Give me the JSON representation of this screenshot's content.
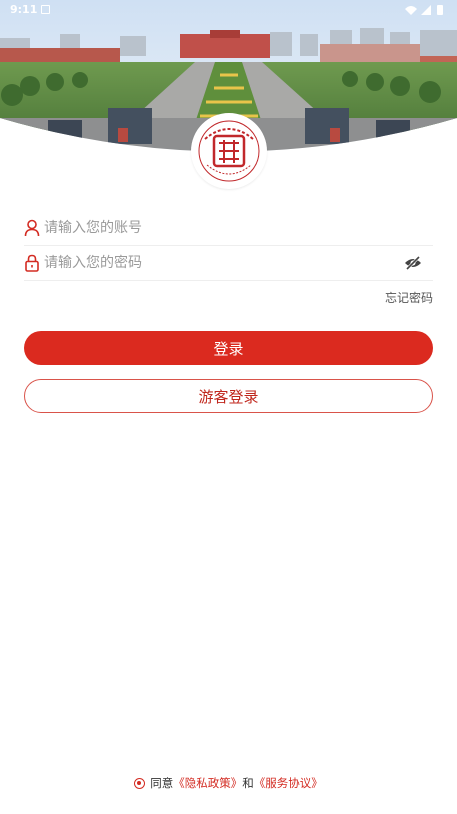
{
  "status_bar": {
    "time": "9:11"
  },
  "login_form": {
    "account_placeholder": "请输入您的账号",
    "password_placeholder": "请输入您的密码",
    "forgot_password": "忘记密码",
    "login_button": "登录",
    "guest_login_button": "游客登录"
  },
  "agreement": {
    "prefix": "同意",
    "privacy_link": "《隐私政策》",
    "conjunction": "和",
    "service_link": "《服务协议》",
    "checked": true
  },
  "colors": {
    "primary": "#db2a1f",
    "link": "#d32b22"
  },
  "icons": [
    "user-icon",
    "lock-icon",
    "eye-off-icon",
    "wifi-icon",
    "signal-icon",
    "battery-icon"
  ]
}
